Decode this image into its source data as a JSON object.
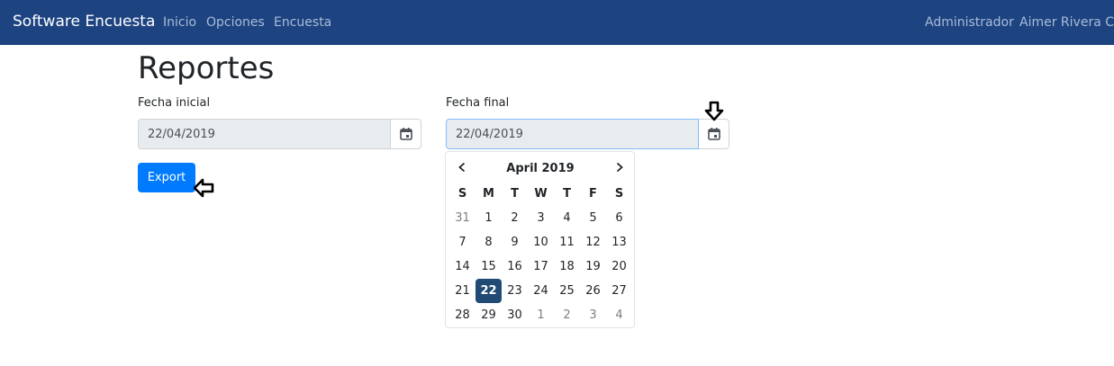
{
  "navbar": {
    "brand": "Software Encuesta",
    "links": [
      "Inicio",
      "Opciones",
      "Encuesta"
    ],
    "right": [
      "Administrador",
      "Aimer Rivera Cer"
    ],
    "bg_color": "#1d4380"
  },
  "page": {
    "title": "Reportes"
  },
  "form": {
    "start": {
      "label": "Fecha inicial",
      "value": "22/04/2019"
    },
    "end": {
      "label": "Fecha final",
      "value": "22/04/2019"
    },
    "export_label": "Export"
  },
  "datepicker": {
    "month_label": "April 2019",
    "weekdays": [
      "S",
      "M",
      "T",
      "W",
      "T",
      "F",
      "S"
    ],
    "weeks": [
      [
        "31",
        "1",
        "2",
        "3",
        "4",
        "5",
        "6"
      ],
      [
        "7",
        "8",
        "9",
        "10",
        "11",
        "12",
        "13"
      ],
      [
        "14",
        "15",
        "16",
        "17",
        "18",
        "19",
        "20"
      ],
      [
        "21",
        "22",
        "23",
        "24",
        "25",
        "26",
        "27"
      ],
      [
        "28",
        "29",
        "30",
        "1",
        "2",
        "3",
        "4"
      ]
    ],
    "selected_day": "22",
    "selected_color": "#214a75"
  },
  "icons": {
    "calendar": "calendar-icon",
    "prev": "chevron-left-icon",
    "next": "chevron-right-icon",
    "annotation_down": "arrow-down-outline-icon",
    "annotation_left": "arrow-left-outline-icon"
  }
}
